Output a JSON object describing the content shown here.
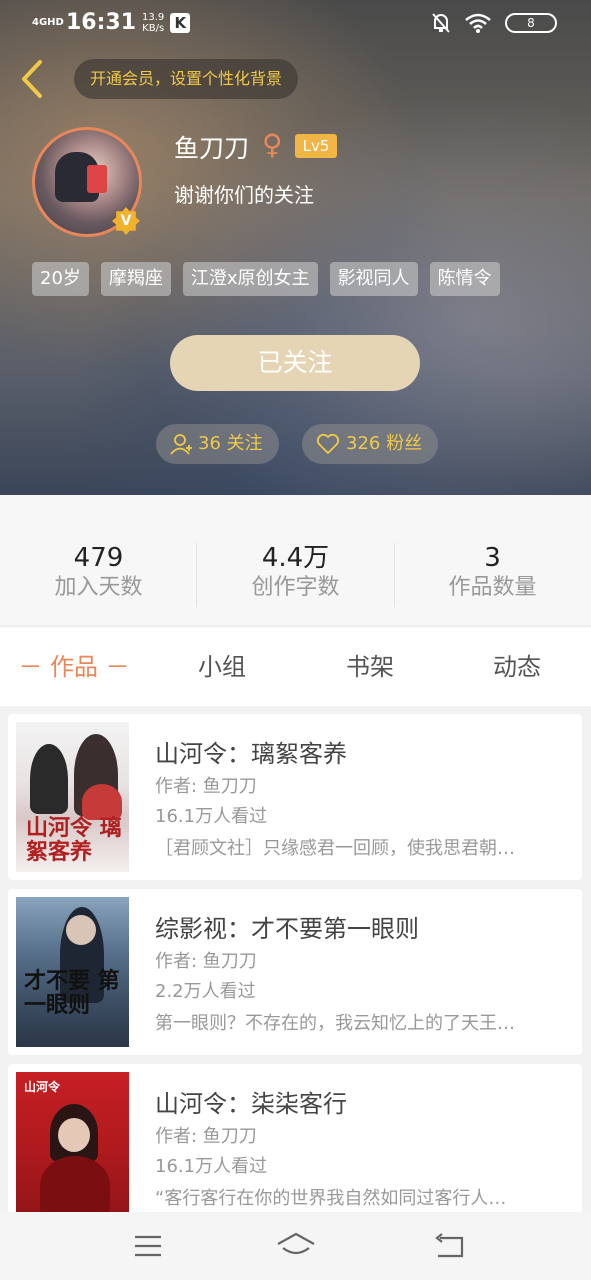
{
  "status_bar": {
    "signal": "4GHD",
    "time": "16:31",
    "speed_value": "13.9",
    "speed_unit": "KB/s",
    "app_badge": "K",
    "battery": "8"
  },
  "header": {
    "vip_text": "开通会员，设置个性化背景",
    "username": "鱼刀刀",
    "gender_symbol": "♀",
    "level": "Lv5",
    "verified_badge": "V",
    "bio": "谢谢你们的关注",
    "tags": [
      "20岁",
      "摩羯座",
      "江澄x原创女主",
      "影视同人",
      "陈情令"
    ],
    "follow_button": "已关注",
    "following_label": "36 关注",
    "fans_label": "326 粉丝"
  },
  "stats": [
    {
      "value": "479",
      "label": "加入天数"
    },
    {
      "value": "4.4万",
      "label": "创作字数"
    },
    {
      "value": "3",
      "label": "作品数量"
    }
  ],
  "tabs": [
    {
      "label": "－ 作品 －",
      "active": true
    },
    {
      "label": "小组",
      "active": false
    },
    {
      "label": "书架",
      "active": false
    },
    {
      "label": "动态",
      "active": false
    }
  ],
  "books": [
    {
      "title": "山河令：璃絮客养",
      "author": "作者: 鱼刀刀",
      "views": "16.1万人看过",
      "desc": "［君顾文社］只缘感君一回顾，使我思君朝…",
      "cover_text": "山河令 璃絮客养"
    },
    {
      "title": "综影视：才不要第一眼则",
      "author": "作者: 鱼刀刀",
      "views": "2.2万人看过",
      "desc": "第一眼则？不存在的，我云知忆上的了天王…",
      "cover_text": "才不要 第一眼则"
    },
    {
      "title": "山河令：柒柒客行",
      "author": "作者: 鱼刀刀",
      "views": "16.1万人看过",
      "desc": "“客行客行在你的世界我自然如同过客行人…",
      "cover_text": "山河令"
    }
  ],
  "colors": {
    "accent": "#e8885a",
    "gold": "#f1c948",
    "follow_button_bg": "#e6d5b4"
  }
}
